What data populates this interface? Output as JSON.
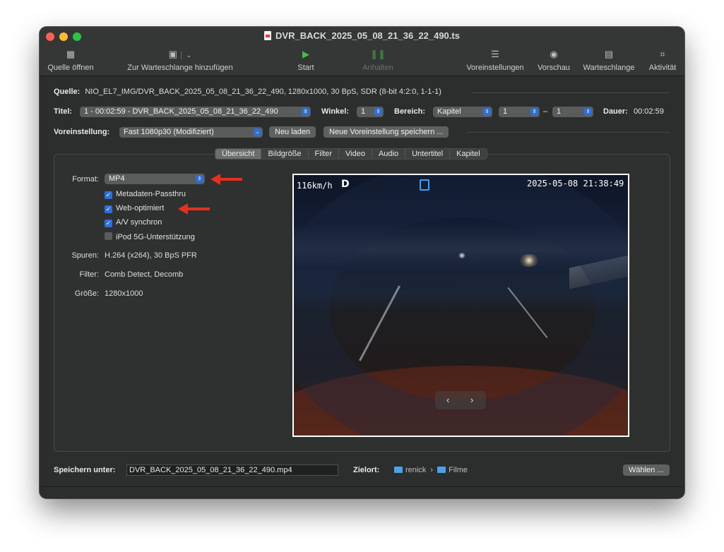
{
  "window": {
    "title": "DVR_BACK_2025_05_08_21_36_22_490.ts"
  },
  "toolbar": {
    "open_source": {
      "label": "Quelle öffnen",
      "icon": "film-icon"
    },
    "add_queue": {
      "label": "Zur Warteschlange hinzufügen",
      "icon": "photo-add-icon"
    },
    "start": {
      "label": "Start",
      "icon": "play-icon"
    },
    "pause": {
      "label": "Anhalten",
      "icon": "pause-icon"
    },
    "presets": {
      "label": "Voreinstellungen",
      "icon": "sliders-icon"
    },
    "preview": {
      "label": "Vorschau",
      "icon": "eye-icon"
    },
    "queue": {
      "label": "Warteschlange",
      "icon": "queue-icon"
    },
    "activity": {
      "label": "Aktivität",
      "icon": "activity-icon"
    }
  },
  "source": {
    "label": "Quelle:",
    "value": "NIO_EL7_IMG/DVR_BACK_2025_05_08_21_36_22_490, 1280x1000, 30 BpS, SDR (8-bit 4:2:0, 1-1-1)"
  },
  "title_row": {
    "title_label": "Titel:",
    "title_value": "1 - 00:02:59 - DVR_BACK_2025_05_08_21_36_22_490",
    "angle_label": "Winkel:",
    "angle_value": "1",
    "range_label": "Bereich:",
    "range_type": "Kapitel",
    "range_from": "1",
    "range_sep": "–",
    "range_to": "1",
    "duration_label": "Dauer:",
    "duration_value": "00:02:59"
  },
  "preset_row": {
    "label": "Voreinstellung:",
    "value": "Fast 1080p30 (Modifiziert)",
    "reload": "Neu laden",
    "save_new": "Neue Voreinstellung speichern ..."
  },
  "tabs": [
    "Übersicht",
    "Bildgröße",
    "Filter",
    "Video",
    "Audio",
    "Untertitel",
    "Kapitel"
  ],
  "summary": {
    "format_label": "Format:",
    "format_value": "MP4",
    "checkboxes": [
      {
        "label": "Metadaten-Passthru",
        "checked": true
      },
      {
        "label": "Web-optimiert",
        "checked": true
      },
      {
        "label": "A/V synchron",
        "checked": true
      },
      {
        "label": "iPod 5G-Unterstützung",
        "checked": false
      }
    ],
    "tracks_label": "Spuren:",
    "tracks_value": "H.264 (x264), 30 BpS PFR",
    "filters_label": "Filter:",
    "filters_value": "Comb Detect, Decomb",
    "size_label": "Größe:",
    "size_value": "1280x1000"
  },
  "preview_osd": {
    "speed": "116km/h",
    "gear": "D",
    "datetime": "2025-05-08  21:38:49",
    "prev": "‹",
    "next": "›"
  },
  "footer": {
    "save_label": "Speichern unter:",
    "save_value": "DVR_BACK_2025_05_08_21_36_22_490.mp4",
    "dest_label": "Zielort:",
    "dest_folder1": "renick",
    "dest_sep": "›",
    "dest_folder2": "Filme",
    "choose": "Wählen ..."
  },
  "colors": {
    "accent": "#2f6fd6",
    "annotation_arrow": "#e53020",
    "play_green": "#3ec43e"
  }
}
